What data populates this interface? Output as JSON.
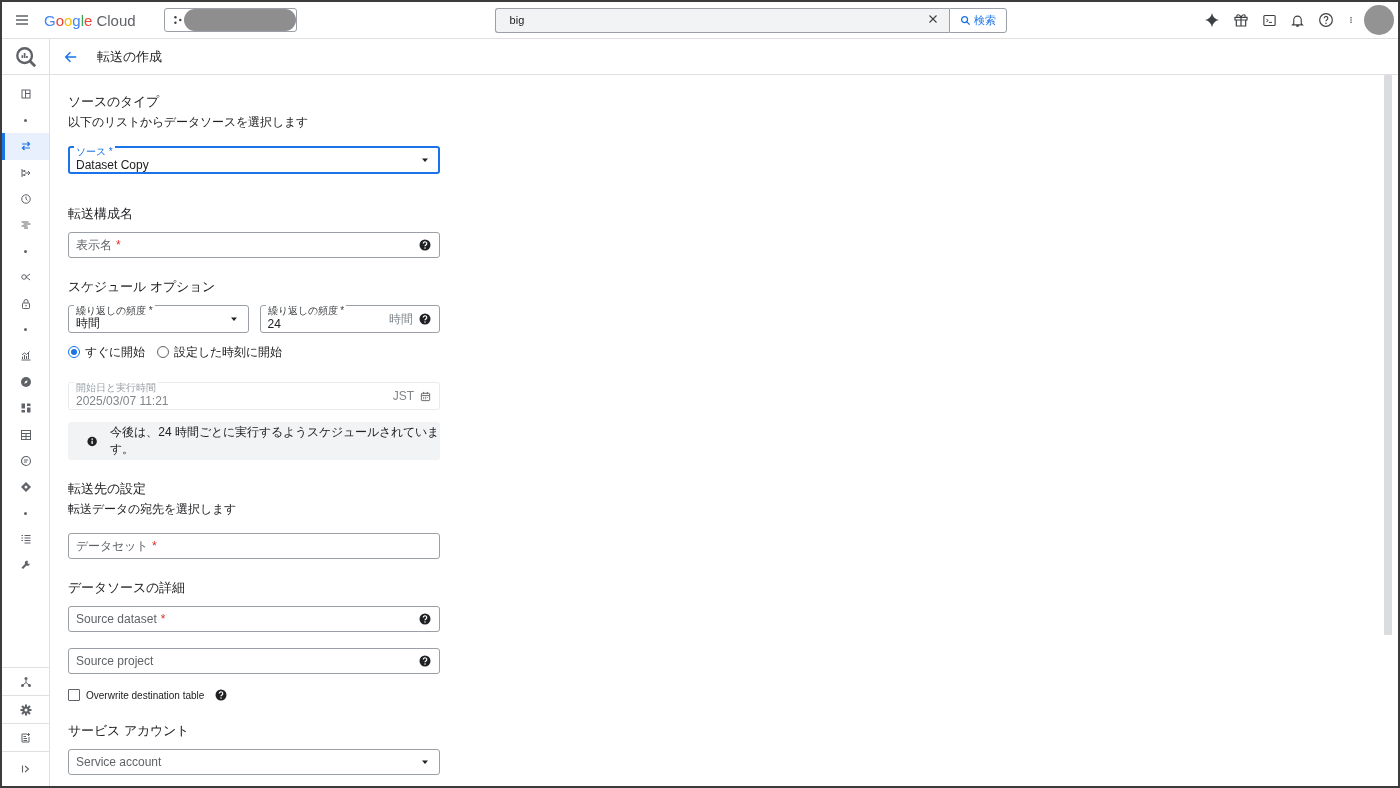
{
  "topbar": {
    "brand_first": "Google",
    "brand_second": "Cloud",
    "search": {
      "value": "big",
      "button": "検索"
    }
  },
  "sidebar": {
    "items": [
      {
        "kind": "icon",
        "selected": false
      },
      {
        "kind": "dot",
        "selected": false
      },
      {
        "kind": "icon",
        "selected": true
      },
      {
        "kind": "icon",
        "selected": false
      },
      {
        "kind": "icon",
        "selected": false
      },
      {
        "kind": "icon",
        "selected": false
      },
      {
        "kind": "dot",
        "selected": false
      },
      {
        "kind": "icon",
        "selected": false
      },
      {
        "kind": "icon",
        "selected": false
      },
      {
        "kind": "dot",
        "selected": false
      },
      {
        "kind": "icon",
        "selected": false
      },
      {
        "kind": "icon",
        "selected": false
      },
      {
        "kind": "icon",
        "selected": false
      },
      {
        "kind": "icon",
        "selected": false
      },
      {
        "kind": "icon",
        "selected": false
      },
      {
        "kind": "icon",
        "selected": false
      },
      {
        "kind": "dot",
        "selected": false
      },
      {
        "kind": "icon",
        "selected": false
      },
      {
        "kind": "icon",
        "selected": false
      }
    ]
  },
  "header": {
    "title": "転送の作成"
  },
  "form": [
    {
      "kind": "heading",
      "text": "ソースのタイプ"
    },
    {
      "kind": "description",
      "text": "以下のリストからデータソースを選択します"
    },
    {
      "kind": "select",
      "label": "ソース *",
      "value": "Dataset Copy",
      "focused": true,
      "disabled": false
    },
    {
      "kind": "heading",
      "text": "転送構成名"
    },
    {
      "kind": "input",
      "placeholder": "表示名",
      "required_mark": "*",
      "help": true,
      "focused": false,
      "disabled": false
    },
    {
      "kind": "heading",
      "text": "スケジュール オプション"
    },
    {
      "kind": "row",
      "fields": [
        {
          "kind": "select",
          "label": "繰り返しの頻度 *",
          "value": "時間",
          "focused": false,
          "disabled": false
        },
        {
          "kind": "input",
          "label": "繰り返しの頻度 *",
          "value": "24",
          "suffix": "時間",
          "help": true,
          "focused": false,
          "disabled": false
        }
      ]
    },
    {
      "kind": "radios",
      "options": [
        {
          "label": "すぐに開始",
          "selected": true
        },
        {
          "label": "設定した時刻に開始",
          "selected": false
        }
      ]
    },
    {
      "kind": "datetime",
      "label": "開始日と実行時間",
      "value": "2025/03/07 11:21",
      "suffix": "JST",
      "focused": false,
      "disabled": true
    },
    {
      "kind": "info",
      "text": "今後は、24 時間ごとに実行するようスケジュールされています。"
    },
    {
      "kind": "heading",
      "text": "転送先の設定"
    },
    {
      "kind": "description",
      "text": "転送データの宛先を選択します"
    },
    {
      "kind": "input",
      "placeholder": "データセット",
      "required_mark": "*",
      "help": false,
      "focused": false,
      "disabled": false
    },
    {
      "kind": "heading",
      "text": "データソースの詳細"
    },
    {
      "kind": "input",
      "placeholder": "Source dataset",
      "required_mark": "*",
      "help": true,
      "focused": false,
      "disabled": false
    },
    {
      "kind": "input",
      "placeholder": "Source project",
      "help": true,
      "focused": false,
      "disabled": false
    },
    {
      "kind": "checkbox",
      "label": "Overwrite destination table",
      "checked": false,
      "help": true
    },
    {
      "kind": "heading",
      "text": "サービス アカウント"
    },
    {
      "kind": "select",
      "placeholder": "Service account",
      "focused": false,
      "disabled": false
    }
  ]
}
